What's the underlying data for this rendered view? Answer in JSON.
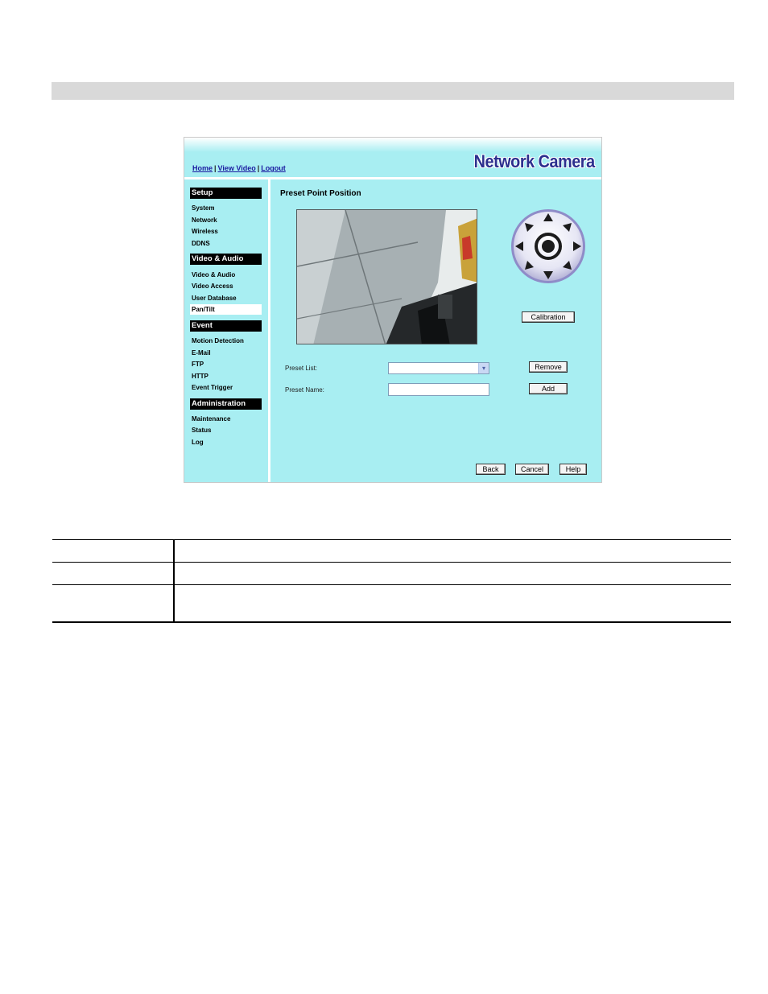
{
  "header": {
    "links": [
      "Home",
      "View Video",
      "Logout"
    ],
    "brand": "Network Camera"
  },
  "sidebar": {
    "sections": [
      {
        "title": "Setup",
        "items": [
          "System",
          "Network",
          "Wireless",
          "DDNS"
        ]
      },
      {
        "title": "Video & Audio",
        "items": [
          "Video & Audio",
          "Video Access",
          "User Database",
          "Pan/Tilt"
        ]
      },
      {
        "title": "Event",
        "items": [
          "Motion Detection",
          "E-Mail",
          "FTP",
          "HTTP",
          "Event Trigger"
        ]
      },
      {
        "title": "Administration",
        "items": [
          "Maintenance",
          "Status",
          "Log"
        ]
      }
    ],
    "active_item": "Pan/Tilt"
  },
  "main": {
    "title": "Preset Point Position",
    "calibration_label": "Calibration",
    "preset_list_label": "Preset List:",
    "preset_list_value": "",
    "preset_name_label": "Preset Name:",
    "preset_name_value": "",
    "remove_label": "Remove",
    "add_label": "Add",
    "back_label": "Back",
    "cancel_label": "Cancel",
    "help_label": "Help"
  },
  "colors": {
    "background": "#a8eef2",
    "section_header": "#000000",
    "brand": "#2c2f8e",
    "link": "#1a1aa0"
  },
  "icons": [
    "ptz-control-icon",
    "chevron-down-icon"
  ]
}
